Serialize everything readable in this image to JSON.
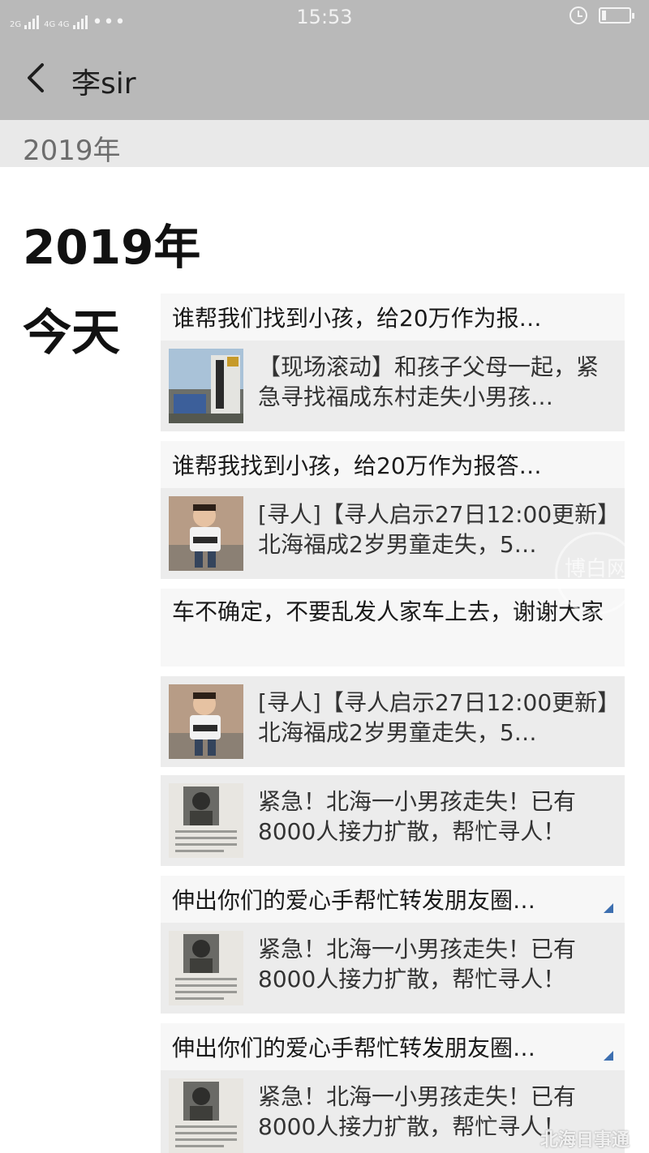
{
  "status_bar": {
    "sim1": "2G",
    "sim2": "4G 4G",
    "dots": "•••",
    "time": "15:53",
    "battery_level": 0.15
  },
  "header": {
    "title": "李sir"
  },
  "section": {
    "label": "2019年"
  },
  "timeline": {
    "year": "2019年",
    "day": "今天"
  },
  "posts": [
    {
      "text": "谁帮我们找到小孩，给20万作为报…",
      "card": "【现场滚动】和孩子父母一起，紧急寻找福成东村走失小男孩…",
      "thumb": "building-photo"
    },
    {
      "text": "谁帮我找到小孩，给20万作为报答…",
      "card": "[寻人]【寻人启示27日12:00更新】北海福成2岁男童走失，5…",
      "thumb": "child-photo"
    },
    {
      "text": "车不确定，不要乱发人家车上去，谢谢大家"
    },
    {
      "card": "[寻人]【寻人启示27日12:00更新】北海福成2岁男童走失，5…",
      "thumb": "child-photo"
    },
    {
      "card": "紧急！北海一小男孩走失！已有8000人接力扩散，帮忙寻人！",
      "thumb": "poster-photo"
    },
    {
      "text": "伸出你们的爱心手帮忙转发朋友圈…",
      "card": "紧急！北海一小男孩走失！已有8000人接力扩散，帮忙寻人！",
      "thumb": "poster-photo"
    },
    {
      "text": "伸出你们的爱心手帮忙转发朋友圈…",
      "card": "紧急！北海一小男孩走失！已有8000人接力扩散，帮忙寻人！",
      "thumb": "poster-photo"
    }
  ],
  "watermark": {
    "logo_text": "博白网",
    "corner_text": "北海日事通"
  }
}
